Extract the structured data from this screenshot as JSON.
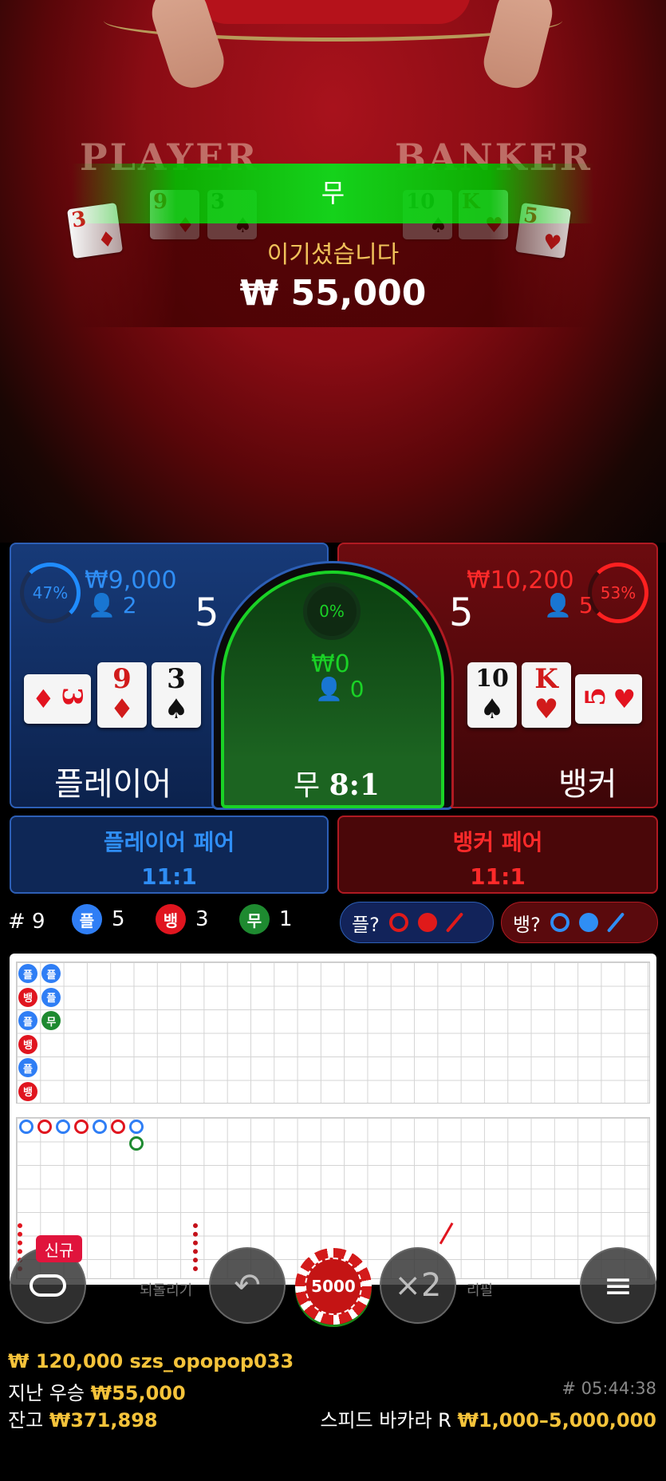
{
  "table": {
    "player_word": "PLAYER",
    "banker_word": "BANKER",
    "result_banner": "무",
    "win_message": "이기셨습니다",
    "win_amount": "₩ 55,000",
    "player_cards": [
      {
        "rank": "3",
        "suit": "♦",
        "color": "#d11b1b"
      },
      {
        "rank": "9",
        "suit": "♦",
        "color": "#d11b1b"
      },
      {
        "rank": "3",
        "suit": "♠",
        "color": "#111111"
      }
    ],
    "banker_cards": [
      {
        "rank": "10",
        "suit": "♠",
        "color": "#111111"
      },
      {
        "rank": "K",
        "suit": "♥",
        "color": "#d11b1b"
      },
      {
        "rank": "5",
        "suit": "♥",
        "color": "#d11b1b"
      }
    ]
  },
  "player": {
    "percent": "47%",
    "amount": "₩9,000",
    "count": "2",
    "score": "5",
    "label": "플레이어",
    "color": "#2f8ef5"
  },
  "tie": {
    "percent": "0%",
    "amount": "₩0",
    "count": "0",
    "label": "무",
    "odds": "8:1",
    "color": "#1ad226"
  },
  "banker": {
    "percent": "53%",
    "amount": "₩10,200",
    "count": "5",
    "score": "5",
    "label": "뱅커",
    "color": "#ff2020"
  },
  "pairs": {
    "player": {
      "title": "플레이어 페어",
      "odds": "11:1"
    },
    "banker": {
      "title": "뱅커 페어",
      "odds": "11:1"
    }
  },
  "stats": {
    "round": "# 9",
    "player_symbol": "플",
    "player_count": "5",
    "banker_symbol": "뱅",
    "banker_count": "3",
    "tie_symbol": "무",
    "tie_count": "1"
  },
  "predict": {
    "player_label": "플?",
    "banker_label": "뱅?"
  },
  "roadmap": {
    "bead_columns": [
      [
        "플",
        "뱅",
        "플",
        "뱅",
        "플",
        "뱅"
      ],
      [
        "플",
        "플",
        "무"
      ]
    ]
  },
  "controls": {
    "new_badge": "신규",
    "chip_value": "5000",
    "double_label": "×2",
    "undo_hint": "되돌리기",
    "repeat_hint": "리필"
  },
  "footer": {
    "bet_amount": "₩ 120,000",
    "username": "szs_opopop033",
    "last_win_label": "지난 우승",
    "last_win_amount": "₩55,000",
    "balance_label": "잔고",
    "balance_amount": "₩371,898",
    "game_id": "# 05:44:38",
    "table_name": "스피드 바카라 R",
    "limits": "₩1,000–5,000,000"
  }
}
